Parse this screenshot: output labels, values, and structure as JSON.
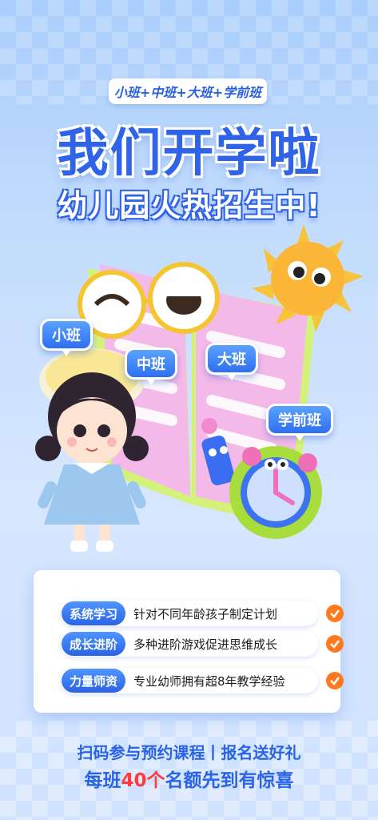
{
  "header": {
    "tagline": "小班+中班+大班+学前班",
    "headline": "我们开学啦",
    "subheadline": "幼儿园火热招生中!"
  },
  "classes": [
    "小班",
    "中班",
    "大班",
    "学前班"
  ],
  "features": [
    {
      "tag": "系统学习",
      "text": "针对不同年龄孩子制定计划"
    },
    {
      "tag": "成长进阶",
      "text": "多种进阶游戏促进思维成长"
    },
    {
      "tag": "力量师资",
      "text": "专业幼师拥有超8年教学经验"
    }
  ],
  "cta": {
    "line1": "扫码参与预约课程丨报名送好礼",
    "line2_prefix": "每班",
    "line2_highlight": "40个",
    "line2_suffix": "名额先到有惊喜"
  },
  "colors": {
    "primary": "#2f63e8",
    "accent": "#ff7a1f",
    "highlight": "#ff3b3b"
  },
  "icons": [
    "sun-icon",
    "book-icon",
    "glasses-icon",
    "alarm-clock-icon",
    "girl-figure",
    "pencil-character-icon",
    "check-icon"
  ]
}
